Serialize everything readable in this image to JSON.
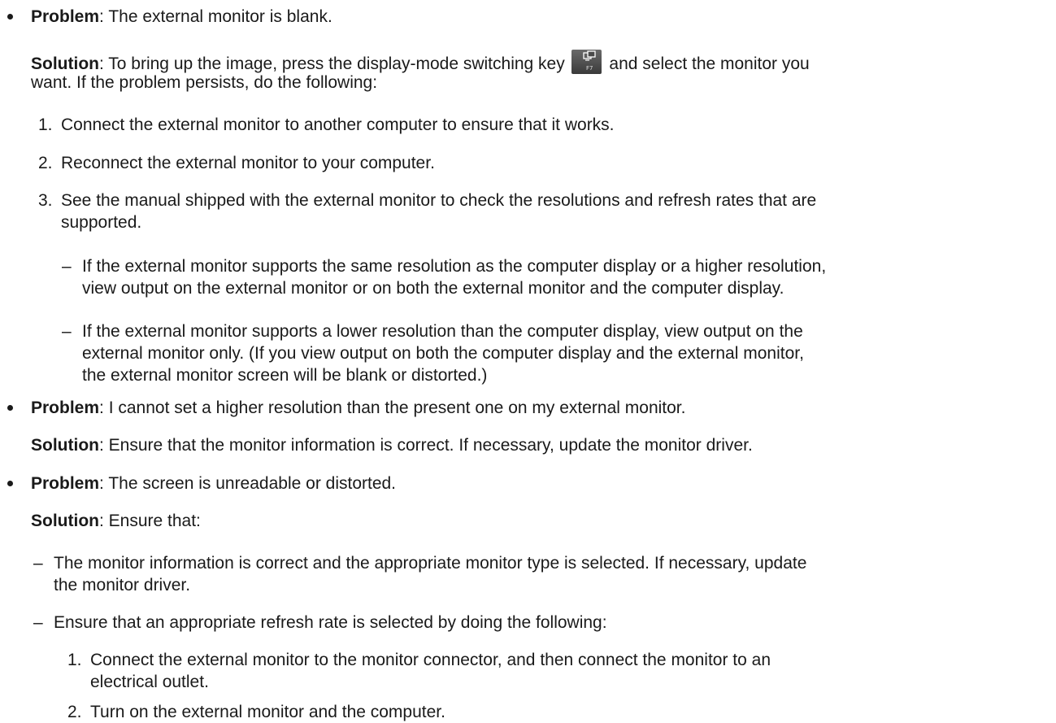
{
  "items": [
    {
      "problem_label": "Problem",
      "problem_text": ": The external monitor is blank.",
      "solution_label": "Solution",
      "solution_text_a": ": To bring up the image, press the display-mode switching key",
      "key_icon": "display-mode-f7-key-icon",
      "key_caption": "F7",
      "solution_text_b": "and select the monitor you",
      "solution_text_c": "want. If the problem persists, do the following:",
      "steps": [
        {
          "num": "1.",
          "text": "Connect the external monitor to another computer to ensure that it works."
        },
        {
          "num": "2.",
          "text": "Reconnect the external monitor to your computer."
        },
        {
          "num": "3.",
          "text_a": "See the manual shipped with the external monitor to check the resolutions and refresh rates that are",
          "text_b": "supported."
        }
      ],
      "subpoints": [
        {
          "dash": "–",
          "text_a": "If the external monitor supports the same resolution as the computer display or a higher resolution,",
          "text_b": "view output on the external monitor or on both the external monitor and the computer display."
        },
        {
          "dash": "–",
          "text_a": "If the external monitor supports a lower resolution than the computer display, view output on the",
          "text_b": "external monitor only. (If you view output on both the computer display and the external monitor,",
          "text_c": "the external monitor screen will be blank or distorted.)"
        }
      ]
    },
    {
      "problem_label": "Problem",
      "problem_text": ": I cannot set a higher resolution than the present one on my external monitor.",
      "solution_label": "Solution",
      "solution_text": ": Ensure that the monitor information is correct. If necessary, update the monitor driver."
    },
    {
      "problem_label": "Problem",
      "problem_text": ": The screen is unreadable or distorted.",
      "solution_label": "Solution",
      "solution_text": ": Ensure that:",
      "subpoints": [
        {
          "dash": "–",
          "text_a": "The monitor information is correct and the appropriate monitor type is selected. If necessary, update",
          "text_b": "the monitor driver."
        },
        {
          "dash": "–",
          "text_a": "Ensure that an appropriate refresh rate is selected by doing the following:"
        }
      ],
      "steps": [
        {
          "num": "1.",
          "text_a": "Connect the external monitor to the monitor connector, and then connect the monitor to an",
          "text_b": "electrical outlet."
        },
        {
          "num": "2.",
          "text": "Turn on the external monitor and the computer."
        }
      ]
    }
  ]
}
